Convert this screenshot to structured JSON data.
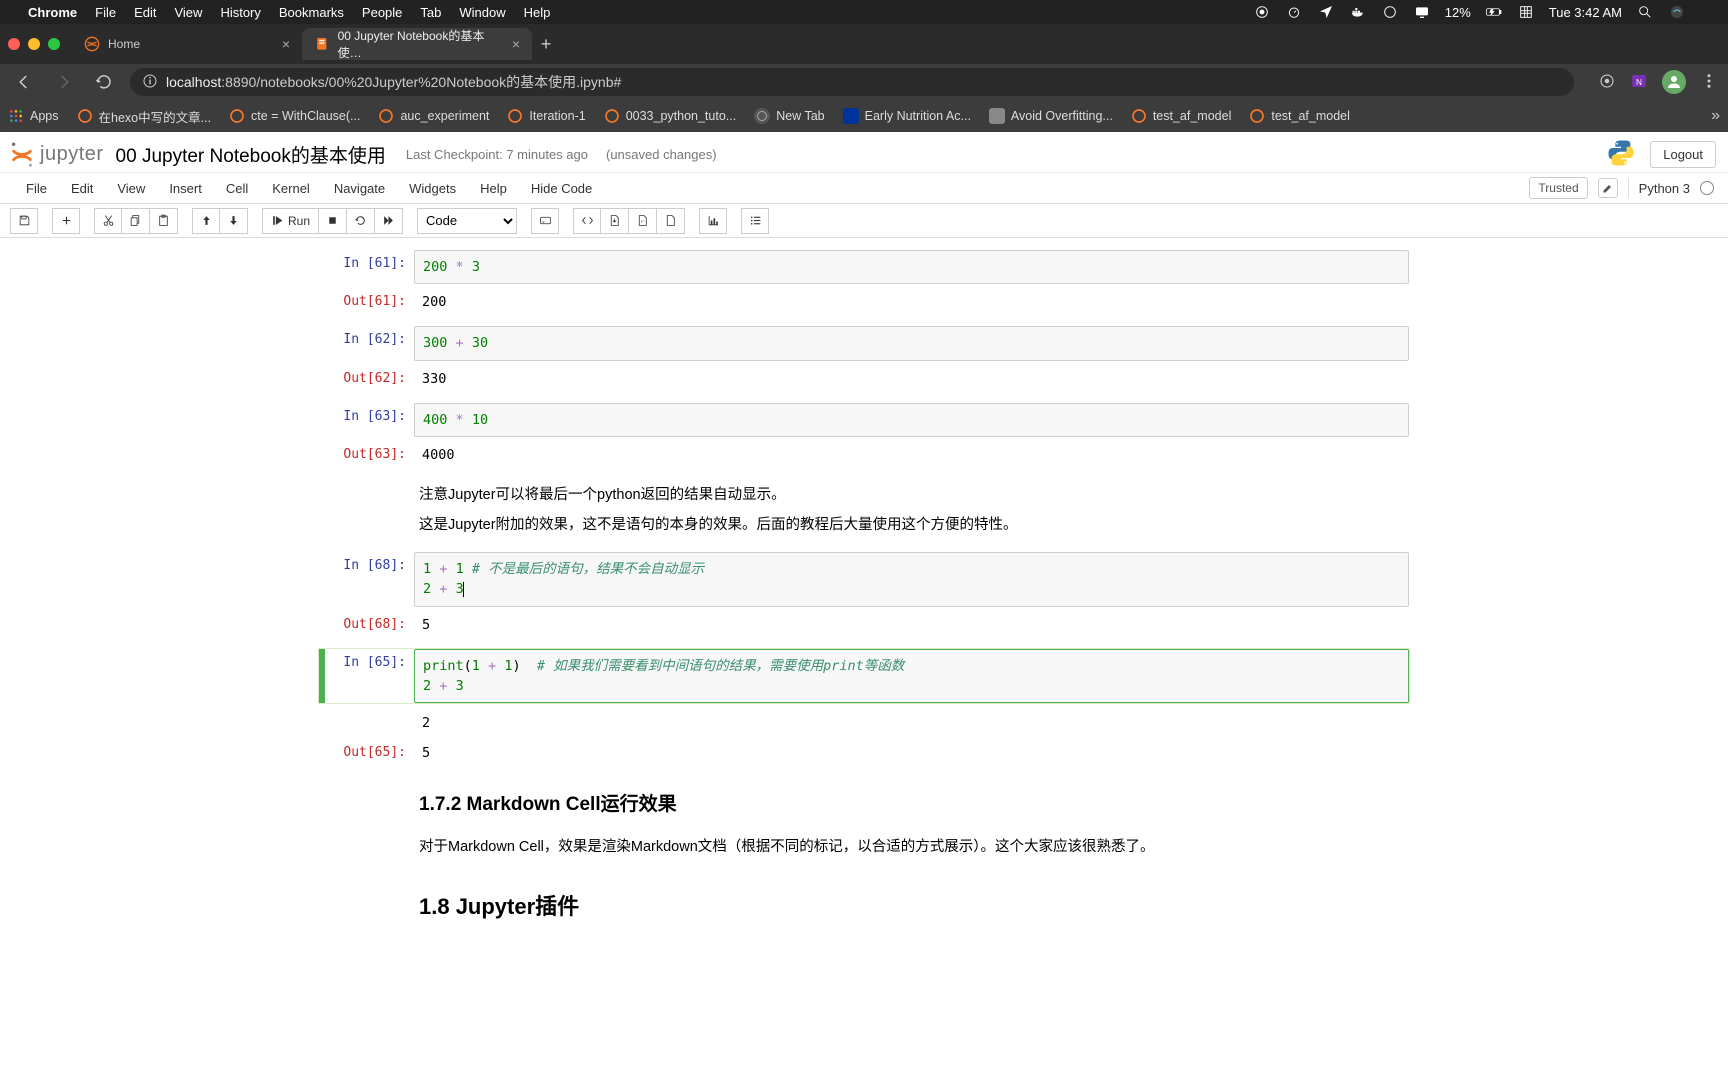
{
  "mac_menu": {
    "app": "Chrome",
    "items": [
      "File",
      "Edit",
      "View",
      "History",
      "Bookmarks",
      "People",
      "Tab",
      "Window",
      "Help"
    ],
    "battery_pct": "12%",
    "clock": "Tue 3:42 AM"
  },
  "chrome": {
    "tabs": [
      {
        "title": "Home",
        "active": false
      },
      {
        "title": "00 Jupyter Notebook的基本使…",
        "active": true
      }
    ],
    "url_host": "localhost",
    "url_path": ":8890/notebooks/00%20Jupyter%20Notebook的基本使用.ipynb#",
    "bookmarks": [
      {
        "label": "Apps",
        "type": "apps"
      },
      {
        "label": "在hexo中写的文章...",
        "type": "jup"
      },
      {
        "label": "cte = WithClause(...",
        "type": "jup"
      },
      {
        "label": "auc_experiment",
        "type": "jup"
      },
      {
        "label": "Iteration-1",
        "type": "jup"
      },
      {
        "label": "0033_python_tuto...",
        "type": "jup"
      },
      {
        "label": "New Tab",
        "type": "globe"
      },
      {
        "label": "Early Nutrition Ac...",
        "type": "eu"
      },
      {
        "label": "Avoid Overfitting...",
        "type": "generic"
      },
      {
        "label": "test_af_model",
        "type": "jup"
      },
      {
        "label": "test_af_model",
        "type": "jup"
      }
    ]
  },
  "jupyter": {
    "nb_title": "00 Jupyter Notebook的基本使用",
    "checkpoint": "Last Checkpoint: 7 minutes ago",
    "unsaved": "(unsaved changes)",
    "logout": "Logout",
    "menu": [
      "File",
      "Edit",
      "View",
      "Insert",
      "Cell",
      "Kernel",
      "Navigate",
      "Widgets",
      "Help",
      "Hide Code"
    ],
    "trusted": "Trusted",
    "kernel": "Python 3",
    "toolbar": {
      "run_label": "Run",
      "celltype": "Code"
    }
  },
  "cells": [
    {
      "in_n": 61,
      "code_parts": [
        {
          "t": "num",
          "v": "200"
        },
        {
          "t": "sp",
          "v": " "
        },
        {
          "t": "op",
          "v": "*"
        },
        {
          "t": "sp",
          "v": " "
        },
        {
          "t": "num",
          "v": "3"
        }
      ],
      "out": "200"
    },
    {
      "in_n": 62,
      "code_parts": [
        {
          "t": "num",
          "v": "300"
        },
        {
          "t": "sp",
          "v": " "
        },
        {
          "t": "op",
          "v": "+"
        },
        {
          "t": "sp",
          "v": " "
        },
        {
          "t": "num",
          "v": "30"
        }
      ],
      "out": "330"
    },
    {
      "in_n": 63,
      "code_parts": [
        {
          "t": "num",
          "v": "400"
        },
        {
          "t": "sp",
          "v": " "
        },
        {
          "t": "op",
          "v": "*"
        },
        {
          "t": "sp",
          "v": " "
        },
        {
          "t": "num",
          "v": "10"
        }
      ],
      "out": "4000"
    },
    {
      "md_lines": [
        "注意Jupyter可以将最后一个python返回的结果自动显示。",
        "这是Jupyter附加的效果，这不是语句的本身的效果。后面的教程后大量使用这个方便的特性。"
      ]
    },
    {
      "in_n": 68,
      "code_html": "<span class=\"tok-num\">1</span> <span class=\"tok-op\">+</span> <span class=\"tok-num\">1</span> <span class=\"tok-comment\"># 不是最后的语句，结果不会自动显示</span>\n<span class=\"tok-num\">2</span> <span class=\"tok-op\">+</span> <span class=\"tok-num\">3</span><span class=\"cursor\"></span>",
      "out": "5"
    },
    {
      "in_n": 65,
      "selected": true,
      "code_html": "<span class=\"tok-builtin\">print</span><span class=\"tok-paren\">(</span><span class=\"tok-num\">1</span> <span class=\"tok-op\">+</span> <span class=\"tok-num\">1</span><span class=\"tok-paren\">)</span>  <span class=\"tok-comment\"># 如果我们需要看到中间语句的结果，需要使用print等函数</span>\n<span class=\"tok-num\">2</span> <span class=\"tok-op\">+</span> <span class=\"tok-num\">3</span>",
      "stdout": "2",
      "out": "5"
    },
    {
      "md_h3": "1.7.2  Markdown Cell运行效果"
    },
    {
      "md_p": "对于Markdown Cell，效果是渲染Markdown文档（根据不同的标记，以合适的方式展示）。这个大家应该很熟悉了。"
    },
    {
      "md_h2": "1.8  Jupyter插件"
    }
  ]
}
